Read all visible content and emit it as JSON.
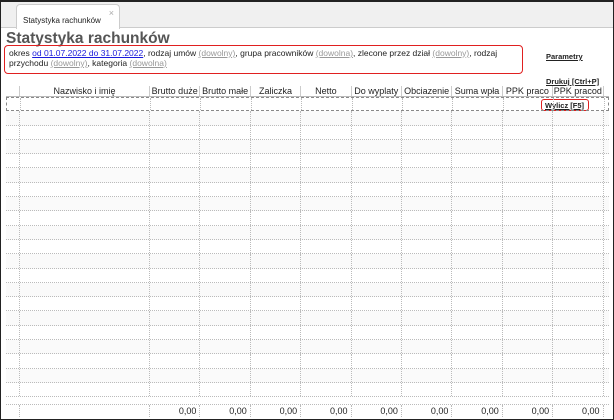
{
  "tab": {
    "label": "Statystyka rachunków",
    "close": "×"
  },
  "title": "Statystyka rachunków",
  "filter": {
    "p1": "okres ",
    "period": "od 01.07.2022 do 31.07.2022",
    "p2": ", rodzaj umów ",
    "v1": "(dowolny)",
    "p3": ", grupa pracowników ",
    "v2": "(dowolna)",
    "p4": ", zlecone przez dział ",
    "v3": "(dowolny)",
    "p5": ", rodzaj przychodu ",
    "v4": "(dowolny)",
    "p6": ", kategoria ",
    "v5": "(dowolna)"
  },
  "actions": {
    "params": "Parametry",
    "print": "Drukuj [Ctrl+P]",
    "calc": "Wylicz [F5]"
  },
  "columns": [
    "Nazwisko i imię",
    "Brutto duże",
    "Brutto małe",
    "Zaliczka",
    "Netto",
    "Do wyplaty",
    "Obciazenie",
    "Suma wpła",
    "PPK praco",
    "PPK pracod"
  ],
  "totals": [
    "0,00",
    "0,00",
    "0,00",
    "0,00",
    "0,00",
    "0,00",
    "0,00",
    "0,00",
    "0,00"
  ]
}
